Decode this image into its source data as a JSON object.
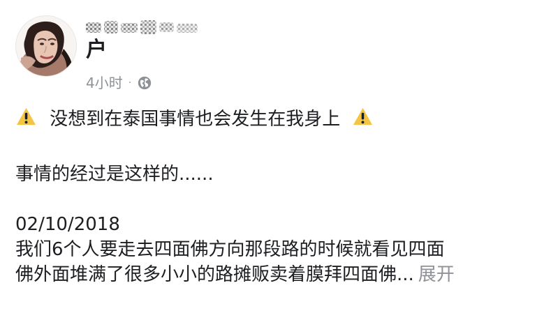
{
  "post": {
    "author_name_suffix": "户",
    "time": "4小时",
    "separator": "·",
    "visibility_icon": "globe-icon",
    "headline": "没想到在泰国事情也会发生在我身上",
    "headline_icon": "warning-icon",
    "line_1": "事情的经过是这样的......",
    "date": "02/10/2018",
    "body_line_1": "我们6个人要走去四面佛方向那段路的时候就看见四面",
    "body_line_2": "佛外面堆满了很多小小的路摊贩卖着膜拜四面佛...",
    "see_more": "展开"
  },
  "colors": {
    "text": "#1c1e21",
    "secondary_text": "#8e9196",
    "warning_yellow": "#f4c542",
    "background": "#ffffff"
  }
}
